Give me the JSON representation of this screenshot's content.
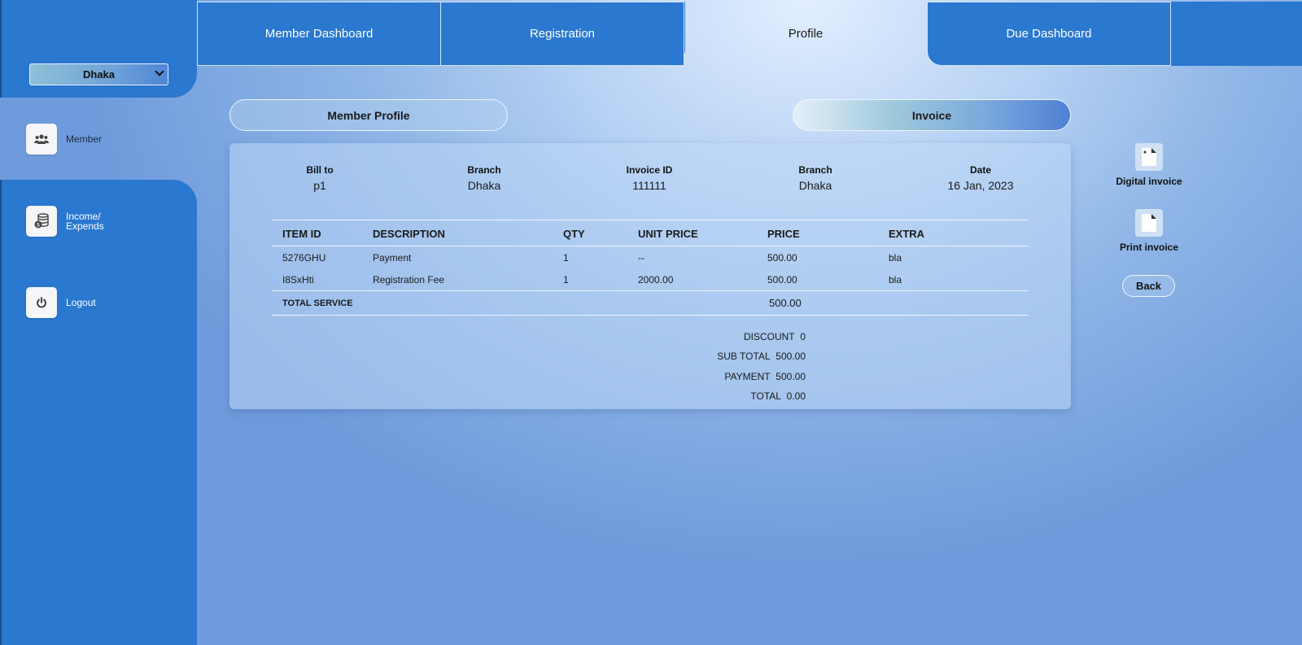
{
  "branch_selector": {
    "value": "Dhaka"
  },
  "sidebar": {
    "items": [
      {
        "label": "Member",
        "icon": "users-icon"
      },
      {
        "label_line1": "Income/",
        "label_line2": "Expends",
        "icon": "coins-icon"
      },
      {
        "label": "Logout",
        "icon": "power-icon"
      }
    ]
  },
  "tabs": [
    {
      "label": "Member Dashboard"
    },
    {
      "label": "Registration"
    },
    {
      "label": "Profile"
    },
    {
      "label": "Due Dashboard"
    }
  ],
  "subtabs": {
    "profile": "Member Profile",
    "invoice": "Invoice"
  },
  "invoice": {
    "meta": [
      {
        "label": "Bill to",
        "value": "p1"
      },
      {
        "label": "Branch",
        "value": "Dhaka"
      },
      {
        "label": "Invoice ID",
        "value": "111111"
      },
      {
        "label": "Branch",
        "value": "Dhaka"
      },
      {
        "label": "Date",
        "value": "16 Jan, 2023"
      }
    ],
    "columns": [
      "ITEM ID",
      "DESCRIPTION",
      "QTY",
      "UNIT PRICE",
      "PRICE",
      "EXTRA"
    ],
    "rows": [
      [
        "5276GHU",
        "Payment",
        "1",
        "--",
        "500.00",
        "bla"
      ],
      [
        "I8SxHti",
        "Registration Fee",
        "1",
        "2000.00",
        "500.00",
        "bla"
      ]
    ],
    "total_service_label": "TOTAL SERVICE",
    "total_service_value": "500.00",
    "summary": [
      {
        "label": "DISCOUNT",
        "value": "0"
      },
      {
        "label": "SUB TOTAL",
        "value": "500.00"
      },
      {
        "label": "PAYMENT",
        "value": "500.00"
      },
      {
        "label": "TOTAL",
        "value": "0.00"
      }
    ]
  },
  "actions": {
    "digital": "Digital invoice",
    "print": "Print invoice",
    "back": "Back"
  },
  "colors": {
    "primary_blue": "#2a78cf",
    "card_bg": "#bed7f5"
  }
}
